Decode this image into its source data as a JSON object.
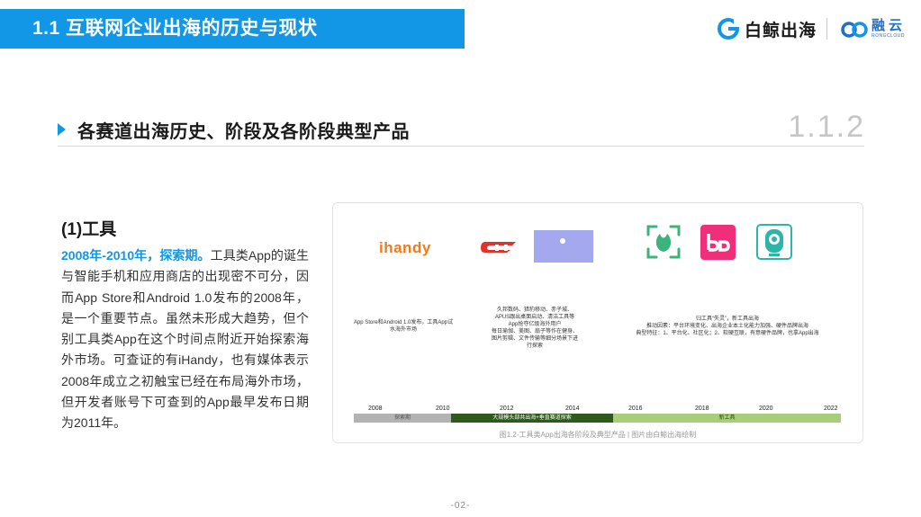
{
  "header": {
    "title": "1.1 互联网企业出海的历史与现状"
  },
  "brands": {
    "baijing": {
      "name": "白鲸出海"
    },
    "rongcloud": {
      "name": "融云",
      "sub": "RONGCLOUD"
    }
  },
  "section": {
    "title": "各赛道出海历史、阶段及各阶段典型产品",
    "number": "1.1.2"
  },
  "content": {
    "subheading": "(1)工具",
    "highlight": "2008年-2010年，探索期。",
    "body": "工具类App的诞生与智能手机和应用商店的出现密不可分，因而App Store和Android 1.0发布的2008年，是一个重要节点。虽然未形成大趋势，但个别工具类App在这个时间点附近开始探索海外市场。可查证的有iHandy，也有媒体表示2008年成立之初触宝已经在布局海外市场，但开发者账号下可查到的App最早发布日期为2011年。"
  },
  "figure": {
    "logos": {
      "ihandy": "ihandy",
      "cm": "CMT"
    },
    "notes": {
      "stage1": "App Store和Android 1.0发布，工具App试水海外市场",
      "stage2": [
        "久邦数码、猎豹移动、赤子城、",
        "APUS跟出桌面启动、清洁工具等",
        "App抢夺亿级海外用户",
        "每日瑜伽、美图、扇子等作在健身、",
        "图片剪辑、文件传输等细分场景下进",
        "行探索"
      ],
      "stage3": [
        "归工具“失灵”，新工具出海",
        "推动因素：平台环境变化、出海企业本土化能力加强、硬件品牌出海",
        "典型特征：1、平台化、社区化；2、软硬互联，有意硬件品牌，也拿App出海"
      ]
    },
    "years": [
      "2008",
      "2010",
      "2012",
      "2014",
      "2016",
      "2018",
      "2020",
      "2022"
    ],
    "bands": [
      "探索期",
      "大规模头部共出海+垂直赛道探索",
      "新工具"
    ],
    "caption": "图1.2-工具类App出海各阶段及典型产品 | 图片由白鲸出海绘制"
  },
  "page": {
    "number": "-02-"
  },
  "colors": {
    "accent": "#1296e6",
    "rongcloud": "#1e6fd0",
    "band_dark": "#2e5a1c",
    "band_light": "#a7cf7b",
    "band_grey": "#b3b3b3"
  }
}
